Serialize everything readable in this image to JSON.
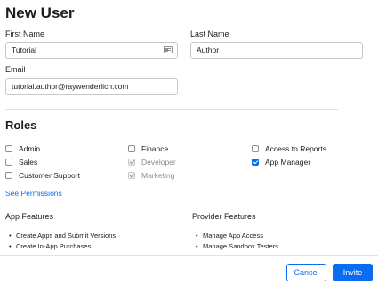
{
  "header": {
    "title": "New User"
  },
  "form": {
    "first_name": {
      "label": "First Name",
      "value": "Tutorial"
    },
    "last_name": {
      "label": "Last Name",
      "value": "Author"
    },
    "email": {
      "label": "Email",
      "value": "tutorial.author@raywenderlich.com"
    }
  },
  "roles": {
    "title": "Roles",
    "items": [
      {
        "label": "Admin",
        "checked": false,
        "disabled": false
      },
      {
        "label": "Sales",
        "checked": false,
        "disabled": false
      },
      {
        "label": "Customer Support",
        "checked": false,
        "disabled": false
      },
      {
        "label": "Finance",
        "checked": false,
        "disabled": false
      },
      {
        "label": "Developer",
        "checked": true,
        "disabled": true
      },
      {
        "label": "Marketing",
        "checked": true,
        "disabled": true
      },
      {
        "label": "Access to Reports",
        "checked": false,
        "disabled": false
      },
      {
        "label": "App Manager",
        "checked": true,
        "disabled": false
      }
    ],
    "see_permissions": "See Permissions"
  },
  "features": {
    "app_title": "App Features",
    "app_items": [
      "Create Apps and Submit Versions",
      "Create In-App Purchases"
    ],
    "provider_title": "Provider Features",
    "provider_items": [
      "Manage App Access",
      "Manage Sandbox Testers"
    ]
  },
  "footer": {
    "cancel_label": "Cancel",
    "invite_label": "Invite"
  },
  "colors": {
    "accent": "#0a6cf0"
  }
}
